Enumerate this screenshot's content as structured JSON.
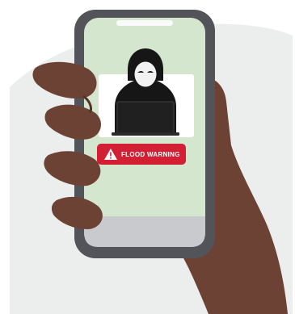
{
  "illustration": {
    "alert": {
      "icon": "warning-triangle-icon",
      "label": "FLOOD WARNING",
      "color": "#d31f34"
    },
    "figure": "hooded-hacker-at-laptop",
    "colors": {
      "skin": "#6b4234",
      "skin_shadow": "#553024",
      "phone_frame": "#52545a",
      "screen": "#d5e6cf",
      "screen_bottom": "#c9cacd",
      "backdrop": "#eceeee",
      "hacker": "#161616"
    }
  }
}
